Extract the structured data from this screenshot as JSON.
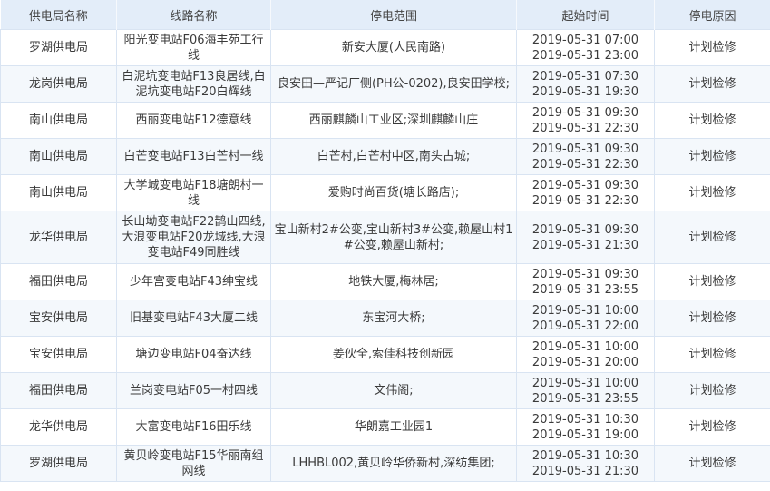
{
  "headers": [
    "供电局名称",
    "线路名称",
    "停电范围",
    "起始时间",
    "停电原因"
  ],
  "rows": [
    {
      "bureau": "罗湖供电局",
      "line": "阳光变电站F06海丰苑工行线",
      "scope": "新安大厦(人民南路)",
      "start": "2019-05-31 07:00",
      "end": "2019-05-31 23:00",
      "reason": "计划检修"
    },
    {
      "bureau": "龙岗供电局",
      "line": "白泥坑变电站F13良居线,白泥坑变电站F20白辉线",
      "scope": "良安田—严记厂侧(PH公-0202),良安田学校;",
      "start": "2019-05-31 07:30",
      "end": "2019-05-31 19:30",
      "reason": "计划检修"
    },
    {
      "bureau": "南山供电局",
      "line": "西丽变电站F12德意线",
      "scope": "西丽麒麟山工业区;深圳麒麟山庄",
      "start": "2019-05-31 09:30",
      "end": "2019-05-31 22:30",
      "reason": "计划检修"
    },
    {
      "bureau": "南山供电局",
      "line": "白芒变电站F13白芒村一线",
      "scope": "白芒村,白芒村中区,南头古城;",
      "start": "2019-05-31 09:30",
      "end": "2019-05-31 22:30",
      "reason": "计划检修"
    },
    {
      "bureau": "南山供电局",
      "line": "大学城变电站F18塘朗村一线",
      "scope": "爱购时尚百货(塘长路店);",
      "start": "2019-05-31 09:30",
      "end": "2019-05-31 22:30",
      "reason": "计划检修"
    },
    {
      "bureau": "龙华供电局",
      "line": "长山坳变电站F22鹊山四线,大浪变电站F20龙城线,大浪变电站F49同胜线",
      "scope": "宝山新村2#公变,宝山新村3#公变,赖屋山村1#公变,赖屋山新村;",
      "start": "2019-05-31 09:30",
      "end": "2019-05-31 21:30",
      "reason": "计划检修"
    },
    {
      "bureau": "福田供电局",
      "line": "少年宫变电站F43绅宝线",
      "scope": "地铁大厦,梅林居;",
      "start": "2019-05-31 09:30",
      "end": "2019-05-31 23:55",
      "reason": "计划检修"
    },
    {
      "bureau": "宝安供电局",
      "line": "旧基变电站F43大厦二线",
      "scope": "东宝河大桥;",
      "start": "2019-05-31 10:00",
      "end": "2019-05-31 22:00",
      "reason": "计划检修"
    },
    {
      "bureau": "宝安供电局",
      "line": "塘边变电站F04奋达线",
      "scope": "姜伙全,索佳科技创新园",
      "start": "2019-05-31 10:00",
      "end": "2019-05-31 20:00",
      "reason": "计划检修"
    },
    {
      "bureau": "福田供电局",
      "line": "兰岗变电站F05一村四线",
      "scope": "文伟阁;",
      "start": "2019-05-31 10:00",
      "end": "2019-05-31 23:55",
      "reason": "计划检修"
    },
    {
      "bureau": "龙华供电局",
      "line": "大富变电站F16田乐线",
      "scope": "华朗嘉工业园1",
      "start": "2019-05-31 10:30",
      "end": "2019-05-31 19:00",
      "reason": "计划检修"
    },
    {
      "bureau": "罗湖供电局",
      "line": "黄贝岭变电站F15华丽南组网线",
      "scope": "LHHBL002,黄贝岭华侨新村,深纺集团;",
      "start": "2019-05-31 10:30",
      "end": "2019-05-31 21:30",
      "reason": "计划检修"
    }
  ]
}
